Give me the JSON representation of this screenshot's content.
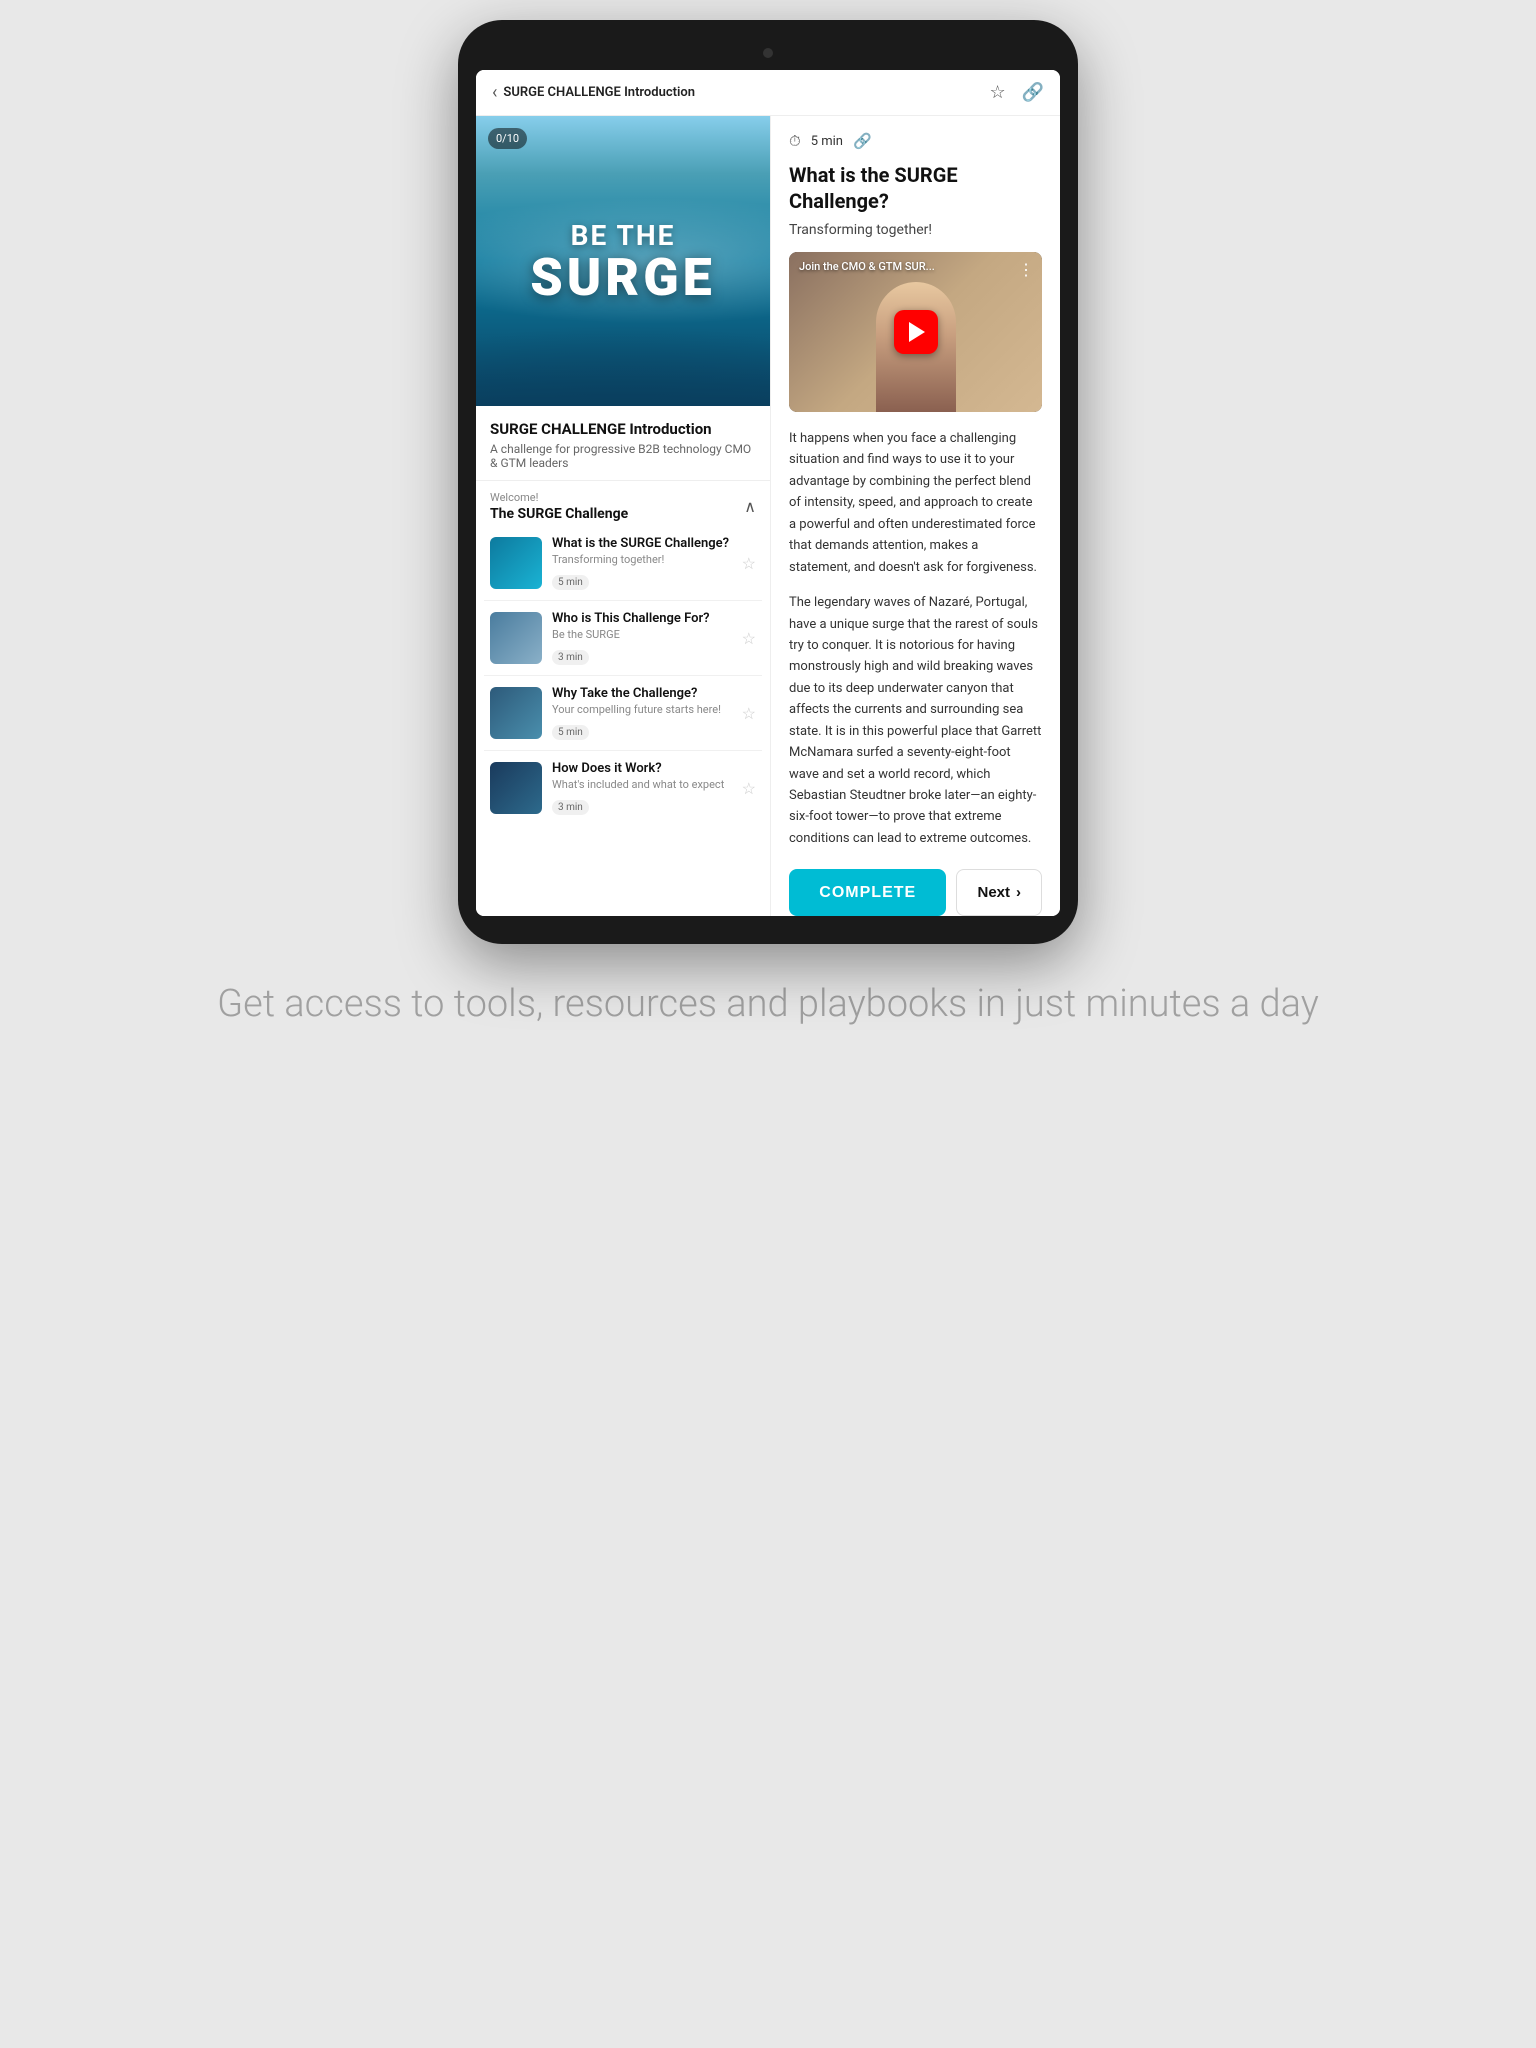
{
  "header": {
    "back_label": "‹",
    "title": "SURGE CHALLENGE Introduction",
    "bookmark_icon": "☆",
    "link_icon": "🔗"
  },
  "hero": {
    "badge": "0/10",
    "line1": "BE THE",
    "line2": "SURGE"
  },
  "course": {
    "title": "SURGE CHALLENGE Introduction",
    "subtitle": "A challenge for progressive B2B technology CMO & GTM leaders"
  },
  "welcome": {
    "label": "Welcome!",
    "course_name": "The SURGE Challenge"
  },
  "lessons": [
    {
      "title": "What is the SURGE Challenge?",
      "desc": "Transforming together!",
      "duration": "5 min",
      "thumb": "wave"
    },
    {
      "title": "Who is This Challenge For?",
      "desc": "Be the SURGE",
      "duration": "3 min",
      "thumb": "road"
    },
    {
      "title": "Why Take the Challenge?",
      "desc": "Your compelling future starts here!",
      "duration": "5 min",
      "thumb": "mountain"
    },
    {
      "title": "How Does it Work?",
      "desc": "What's included and what to expect",
      "duration": "3 min",
      "thumb": "compass"
    }
  ],
  "content": {
    "meta_time": "5 min",
    "title": "What is the SURGE Challenge?",
    "subtitle": "Transforming together!",
    "video_title": "Join the CMO & GTM SUR...",
    "body1": "It happens when you face a challenging situation and find ways to use it to your advantage by combining the perfect blend of intensity, speed, and approach to create a powerful and often underestimated force that demands attention, makes a statement, and doesn't ask for forgiveness.",
    "body2": "The legendary waves of Nazaré, Portugal, have a unique surge that the rarest of souls try to conquer. It is notorious for having monstrously high and wild breaking waves due to its deep underwater canyon that affects the currents and surrounding sea state. It is in this powerful place that Garrett McNamara surfed a seventy-eight-foot wave and set a world record, which Sebastian Steudtner broke later—an eighty-six-foot tower—to prove that extreme conditions can lead to extreme outcomes.",
    "btn_complete": "COMPLETE",
    "btn_next": "Next"
  },
  "bottom_text": "Get access to tools, resources and playbooks in just minutes a day"
}
